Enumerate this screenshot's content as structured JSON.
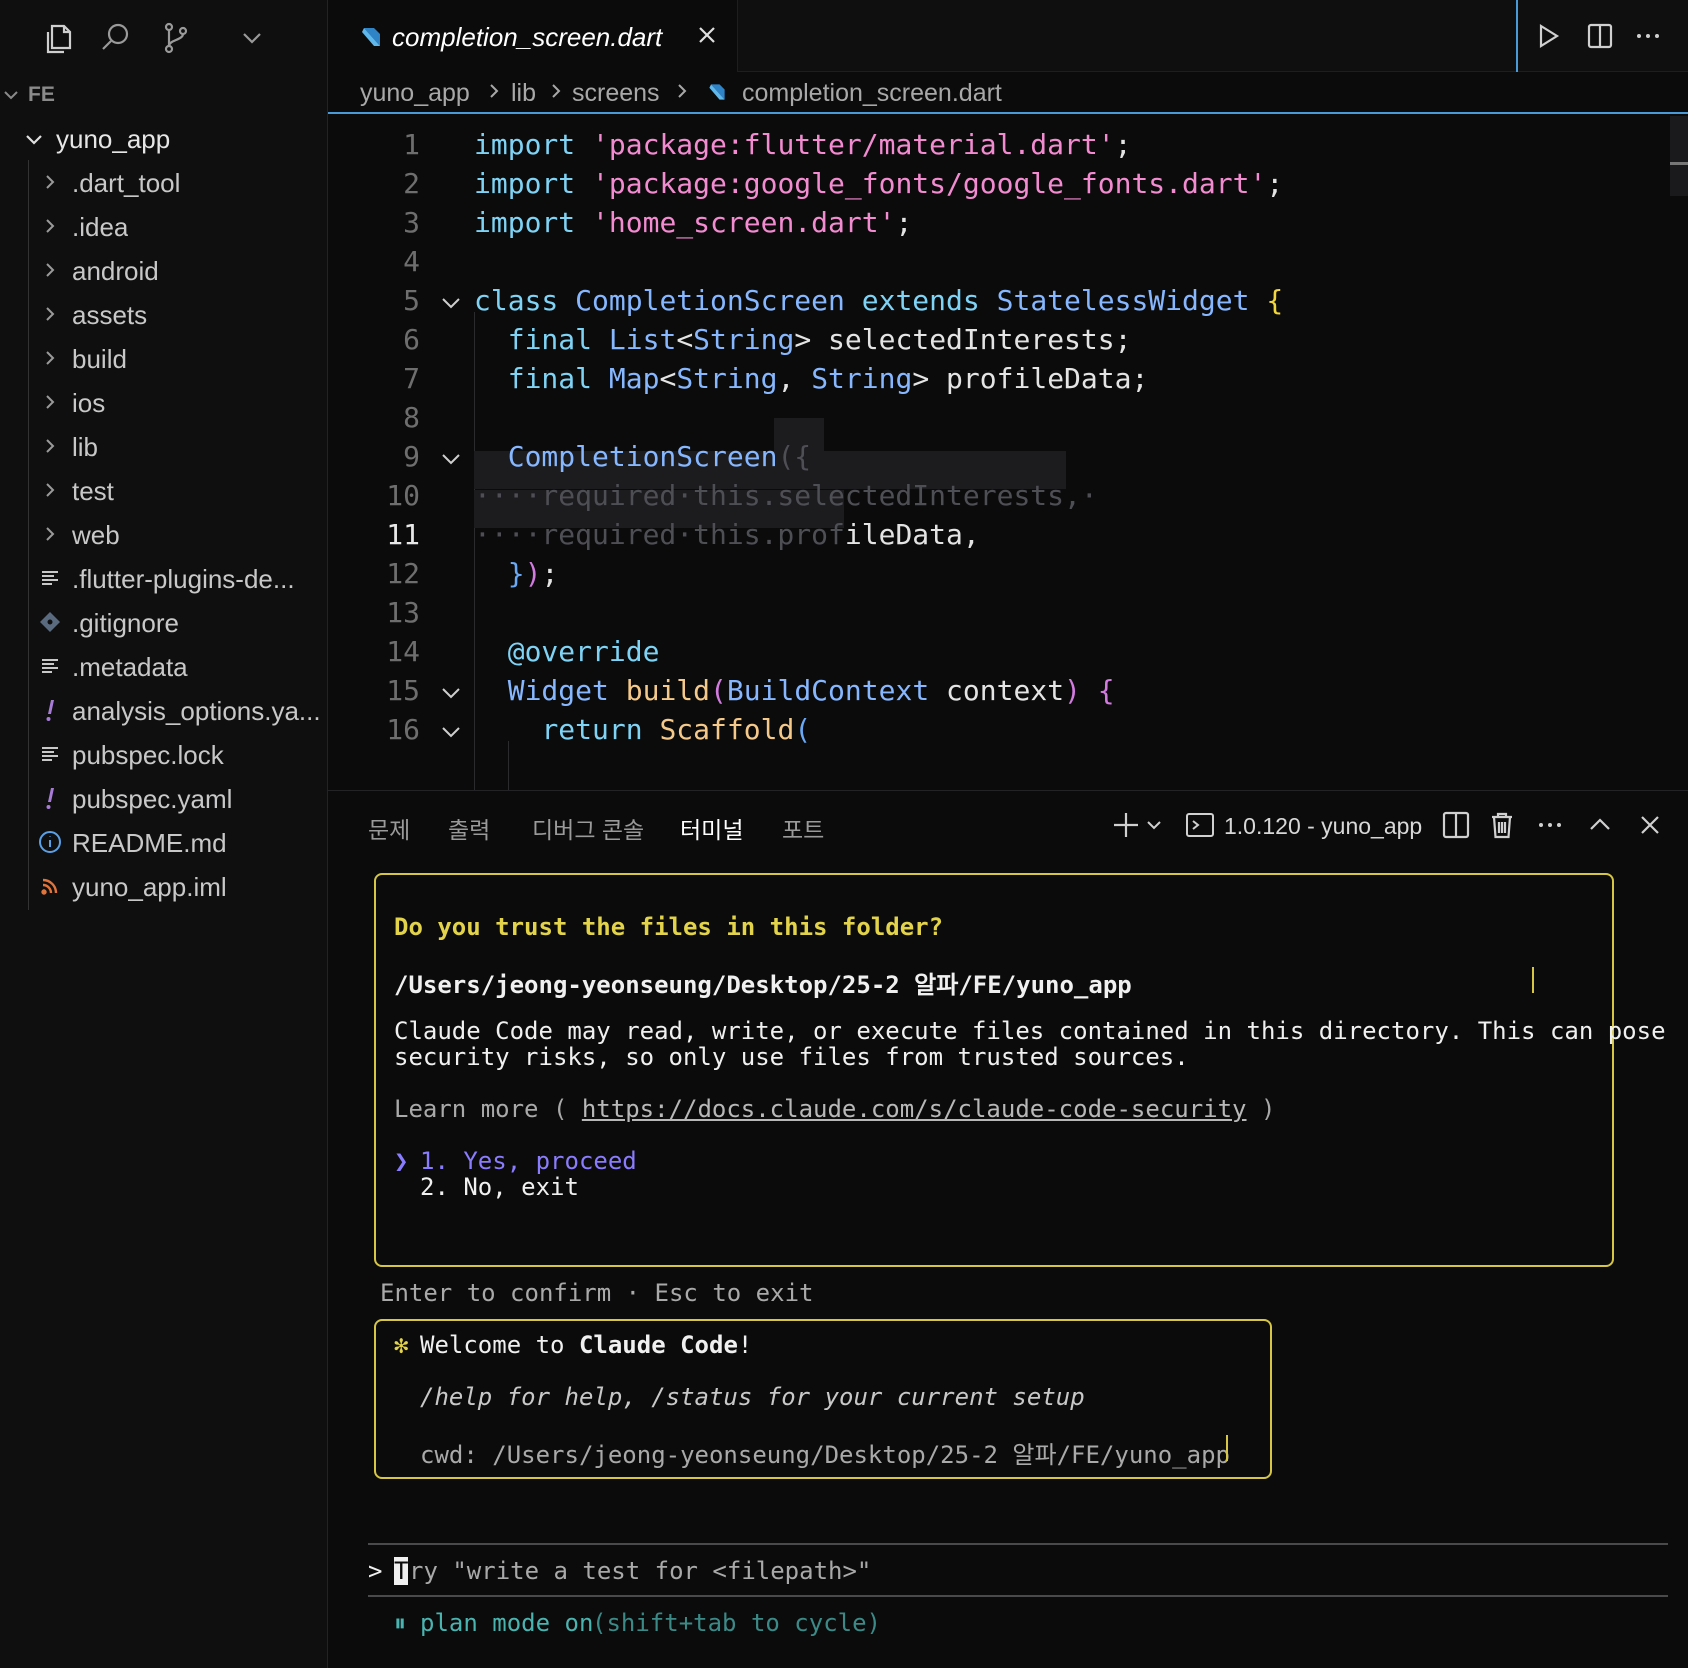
{
  "sidebar": {
    "section_label": "FE",
    "root_folder": "yuno_app",
    "items": [
      {
        "label": ".dart_tool",
        "icon": "chevron-right-icon",
        "icon_color": "#9a9a9a"
      },
      {
        "label": ".idea",
        "icon": "chevron-right-icon",
        "icon_color": "#9a9a9a"
      },
      {
        "label": "android",
        "icon": "chevron-right-icon",
        "icon_color": "#9a9a9a"
      },
      {
        "label": "assets",
        "icon": "chevron-right-icon",
        "icon_color": "#9a9a9a"
      },
      {
        "label": "build",
        "icon": "chevron-right-icon",
        "icon_color": "#9a9a9a"
      },
      {
        "label": "ios",
        "icon": "chevron-right-icon",
        "icon_color": "#9a9a9a"
      },
      {
        "label": "lib",
        "icon": "chevron-right-icon",
        "icon_color": "#9a9a9a"
      },
      {
        "label": "test",
        "icon": "chevron-right-icon",
        "icon_color": "#9a9a9a"
      },
      {
        "label": "web",
        "icon": "chevron-right-icon",
        "icon_color": "#9a9a9a"
      },
      {
        "label": ".flutter-plugins-de...",
        "icon": "lines-file-icon",
        "icon_color": "#c8c8c8"
      },
      {
        "label": ".gitignore",
        "icon": "git-file-icon",
        "icon_color": "#5a6b80"
      },
      {
        "label": ".metadata",
        "icon": "lines-file-icon",
        "icon_color": "#c8c8c8"
      },
      {
        "label": "analysis_options.ya...",
        "icon": "yaml-exclamation-icon",
        "icon_color": "#a77bd6"
      },
      {
        "label": "pubspec.lock",
        "icon": "lines-file-icon",
        "icon_color": "#c8c8c8"
      },
      {
        "label": "pubspec.yaml",
        "icon": "yaml-exclamation-icon",
        "icon_color": "#a77bd6"
      },
      {
        "label": "README.md",
        "icon": "info-file-icon",
        "icon_color": "#5aa0e6"
      },
      {
        "label": "yuno_app.iml",
        "icon": "rss-file-icon",
        "icon_color": "#e0743a"
      }
    ]
  },
  "editor": {
    "tab_name": "completion_screen.dart",
    "breadcrumb": [
      "yuno_app",
      "lib",
      "screens",
      "completion_screen.dart"
    ],
    "current_line": 11
  },
  "panel": {
    "tabs": [
      "문제",
      "출력",
      "디버그 콘솔",
      "터미널",
      "포트"
    ],
    "active_tab": "터미널",
    "terminal_name": "1.0.120 - yuno_app"
  },
  "terminal": {
    "trust_title": "Do you trust the files in this folder?",
    "trust_path": "/Users/jeong-yeonseung/Desktop/25-2 알파/FE/yuno_app",
    "trust_desc_1": "Claude Code may read, write, or execute files contained in this directory. This can pose",
    "trust_desc_2": "security risks, so only use files from trusted sources.",
    "learn_more_prefix": "Learn more ( ",
    "learn_more_url": "https://docs.claude.com/s/claude-code-security",
    "learn_more_suffix": " )",
    "option_pointer": "❯",
    "option_1": "1. Yes, proceed",
    "option_2": "2. No, exit",
    "confirm_hint": "Enter to confirm · Esc to exit",
    "welcome_star": "✻",
    "welcome_prefix": "Welcome to ",
    "welcome_brand": "Claude Code",
    "welcome_suffix": "!",
    "help_text": "/help for help, /status for your current setup",
    "cwd_text": "cwd: /Users/jeong-yeonseung/Desktop/25-2 알파/FE/yuno_app",
    "prompt_symbol": ">",
    "prompt_first_char": "T",
    "prompt_placeholder": "ry \"write a test for <filepath>\"",
    "mode_icon": "⏸",
    "mode_text": "plan mode on",
    "mode_hint": "(shift+tab to cycle)"
  },
  "colors": {
    "accent_blue": "#4a9ad9",
    "box_yellow": "#d6c646",
    "title_yellow": "#e2d34a",
    "option_purple": "#8a7cff",
    "mode_teal": "#49b4b0"
  }
}
